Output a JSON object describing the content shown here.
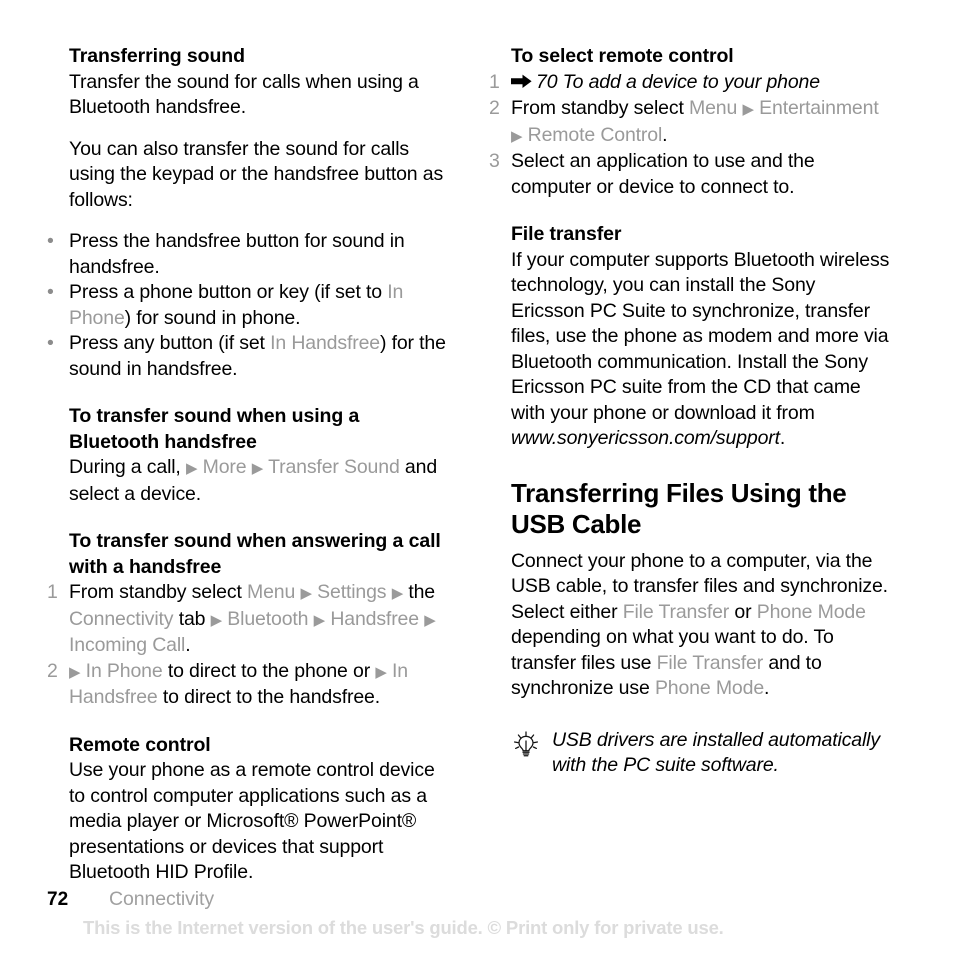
{
  "document": {
    "page_number": "72",
    "chapter": "Connectivity",
    "watermark": "This is the Internet version of the user's guide. © Print only for private use."
  },
  "left_column": {
    "section1": {
      "heading": "Transferring sound",
      "para1": "Transfer the sound for calls when using a Bluetooth handsfree.",
      "para2": "You can also transfer the sound for calls using the keypad or the handsfree button as follows:",
      "bullets": [
        {
          "before": "Press the handsfree button for sound in handsfree.",
          "ui": "",
          "after": ""
        },
        {
          "before": "Press a phone button or key (if set to ",
          "ui": "In Phone",
          "after": ") for sound in phone."
        },
        {
          "before": "Press any button (if set ",
          "ui": "In Handsfree",
          "after": ") for the sound in handsfree."
        }
      ]
    },
    "section2": {
      "heading": "To transfer sound when using a Bluetooth handsfree",
      "body_before": "During a call, ",
      "body_ui1": "More",
      "body_ui2": "Transfer Sound",
      "body_after": " and select a device."
    },
    "section3": {
      "heading": "To transfer sound when answering a call with a handsfree",
      "steps": [
        {
          "number": "1",
          "t1": "From standby select ",
          "u1": "Menu",
          "u2": "Settings",
          "t2": " the ",
          "u3": "Connectivity",
          "t3": " tab ",
          "u4": "Bluetooth",
          "u5": "Handsfree",
          "u6": "Incoming Call",
          "t4": "."
        },
        {
          "number": "2",
          "u1": "In Phone",
          "t1": " to direct to the phone or ",
          "u2": "In Handsfree",
          "t2": " to direct to the handsfree."
        }
      ]
    },
    "section4": {
      "heading": "Remote control",
      "para": "Use your phone as a remote control device to control computer applications such as a media player or Microsoft® PowerPoint® presentations or devices that support Bluetooth HID Profile."
    }
  },
  "right_column": {
    "section1": {
      "heading": "To select remote control",
      "steps": [
        {
          "number": "1",
          "arrow_icon": "solid-right-arrow",
          "italic": "70 To add a device to your phone"
        },
        {
          "number": "2",
          "t1": "From standby select ",
          "u1": "Menu",
          "u2": "Entertainment",
          "u3": "Remote Control",
          "t2": "."
        },
        {
          "number": "3",
          "t1": "Select an application to use and the computer or device to connect to."
        }
      ]
    },
    "section2": {
      "heading": "File transfer",
      "para_part1": "If your computer supports Bluetooth wireless technology, you can install the Sony Ericsson PC Suite to synchronize, transfer files, use the phone as modem and more via Bluetooth communication. Install the Sony Ericsson PC suite from the CD that came with your phone or download it from ",
      "para_url": "www.sonyericsson.com/support",
      "para_part2": "."
    },
    "section3": {
      "heading": "Transferring Files Using the USB Cable",
      "t1": "Connect your phone to a computer, via the USB cable, to transfer files and synchronize. Select either ",
      "u1": "File Transfer",
      "t2": " or ",
      "u2": "Phone Mode",
      "t3": " depending on what you want to do. To transfer files use ",
      "u3": "File Transfer",
      "t4": " and to synchronize use ",
      "u4": "Phone Mode",
      "t5": "."
    },
    "tip": {
      "icon": "lightbulb-icon",
      "text": "USB drivers are installed automatically with the PC suite software."
    }
  },
  "colors": {
    "ui_term_gray": "#9a9a9a",
    "chapter_gray": "#a0a0a0",
    "watermark_gray": "#dcdcdc",
    "text_black": "#000000"
  }
}
